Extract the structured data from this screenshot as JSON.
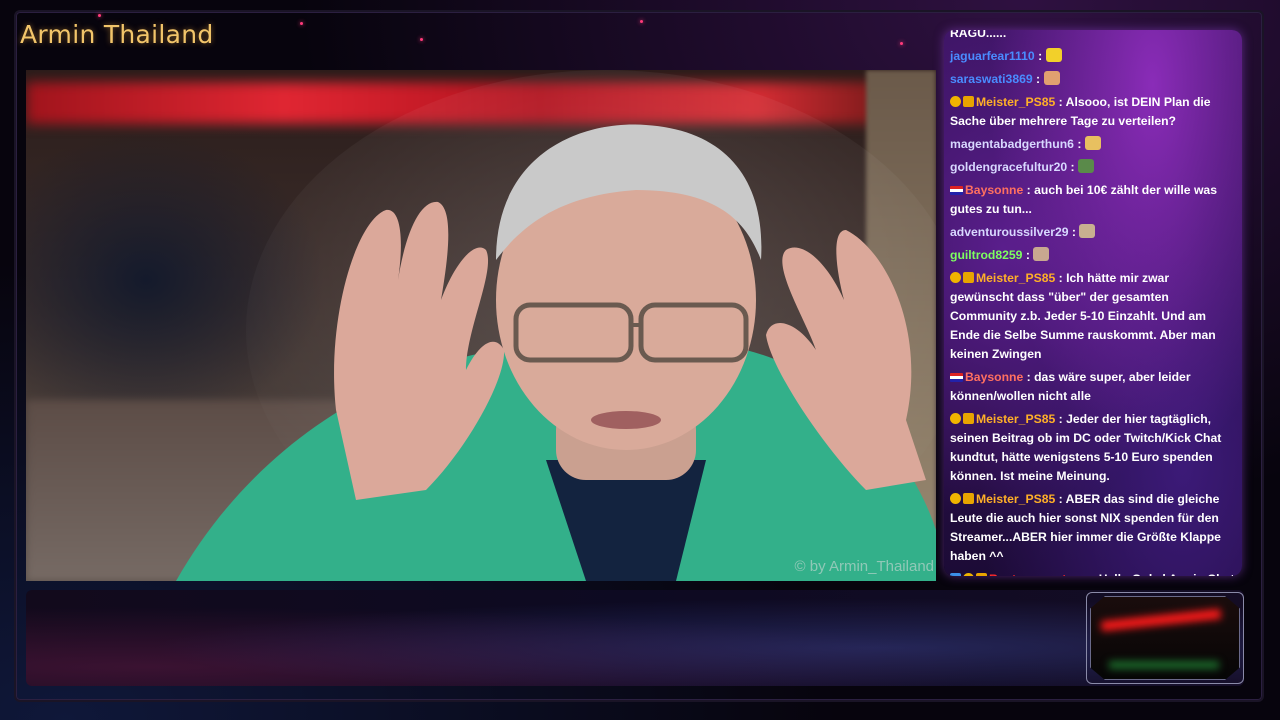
{
  "overlay": {
    "channel_title": "Armin Thailand",
    "watermark": "© by Armin_Thailand"
  },
  "chat": {
    "messages": [
      {
        "user": "RAGU......",
        "text": "",
        "user_color": "#ffffff",
        "badges": []
      },
      {
        "user": "jaguarfear1110",
        "text": "",
        "user_color": "#4a8cff",
        "badges": [],
        "emote": "emote-yellow"
      },
      {
        "user": "saraswati3869",
        "text": "",
        "user_color": "#4a8cff",
        "badges": [],
        "emote": "emote-hand"
      },
      {
        "user": "Meister_PS85",
        "text": "Alsooo, ist DEIN Plan die Sache über mehrere Tage zu verteilen?",
        "user_color": "#ffb028",
        "badges": [
          "gold-badge",
          "crown-badge"
        ]
      },
      {
        "user": "magentabadgerthun6",
        "text": "",
        "user_color": "#d8d8ff",
        "badges": [],
        "emote": "emote-face"
      },
      {
        "user": "goldengracefultur20",
        "text": "",
        "user_color": "#d8d8ff",
        "badges": [],
        "emote": "emote-turtle"
      },
      {
        "user": "Baysonne",
        "text": "auch bei 10€ zählt der wille was gutes zu tun...",
        "user_color": "#ff7060",
        "badges": [
          "flag-badge"
        ]
      },
      {
        "user": "adventuroussilver29",
        "text": "",
        "user_color": "#d8d8ff",
        "badges": [],
        "emote": "emote-small"
      },
      {
        "user": "guiltrod8259",
        "text": "",
        "user_color": "#7dff60",
        "badges": [],
        "emote": "emote-square"
      },
      {
        "user": "Meister_PS85",
        "text": "Ich hätte mir zwar gewünscht dass \"über\" der gesamten Community z.b. Jeder 5-10 Einzahlt. Und am Ende die Selbe Summe rauskommt. Aber man keinen Zwingen",
        "user_color": "#ffb028",
        "badges": [
          "gold-badge",
          "crown-badge"
        ]
      },
      {
        "user": "Baysonne",
        "text": "das wäre super, aber leider können/wollen nicht alle",
        "user_color": "#ff7060",
        "badges": [
          "flag-badge"
        ]
      },
      {
        "user": "Meister_PS85",
        "text": "Jeder der hier tagtäglich, seinen Beitrag ob im DC oder Twitch/Kick Chat kundtut, hätte wenigstens 5-10 Euro spenden können. Ist meine Meinung.",
        "user_color": "#ffb028",
        "badges": [
          "gold-badge",
          "crown-badge"
        ]
      },
      {
        "user": "Meister_PS85",
        "text": "ABER das sind die gleiche Leute die auch hier sonst NIX spenden für den Streamer...ABER hier immer die Größte Klappe haben ^^",
        "user_color": "#ffb028",
        "badges": [
          "gold-badge",
          "crown-badge"
        ]
      },
      {
        "user": "Rostamannstone",
        "text": "Hallo Onkel Armin Chat",
        "user_color": "#ff2a2a",
        "badges": [
          "blue-badge",
          "gold-badge",
          "crown-badge"
        ]
      }
    ]
  },
  "colors": {
    "title": "#f2c56a",
    "chat_bg": "#3a1460",
    "accent_purple": "#8a2cb8"
  }
}
